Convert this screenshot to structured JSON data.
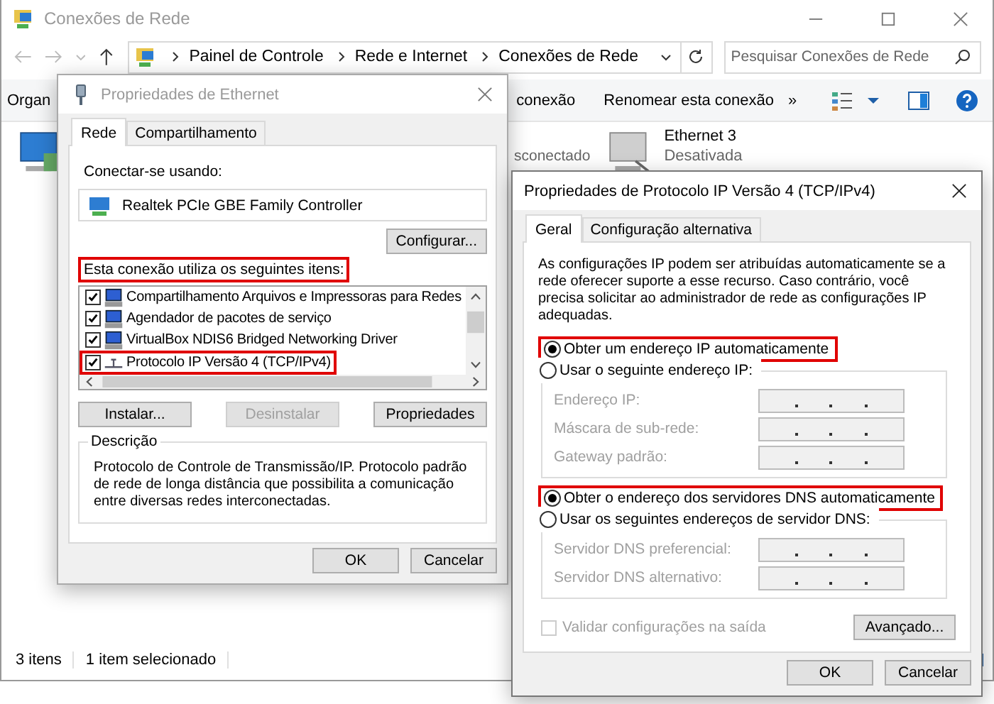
{
  "window": {
    "title": "Conexões de Rede"
  },
  "address_bar": {
    "breadcrumbs": [
      "Painel de Controle",
      "Rede e Internet",
      "Conexões de Rede"
    ]
  },
  "search": {
    "placeholder": "Pesquisar Conexões de Rede"
  },
  "toolbar": {
    "commands": [
      "Organ",
      "conexão",
      "Renomear esta conexão",
      "»"
    ]
  },
  "connections": [
    {
      "status": "sconectado"
    },
    {
      "name": "Ethernet 3",
      "status": "Desativada"
    }
  ],
  "status_bar": [
    "3 itens",
    "1 item selecionado"
  ],
  "ethernet_dialog": {
    "title": "Propriedades de Ethernet",
    "tabs": [
      {
        "label": "Rede",
        "selected": true
      },
      {
        "label": "Compartilhamento",
        "selected": false
      }
    ],
    "connect_label": "Conectar-se usando:",
    "adapter": "Realtek PCIe GBE Family Controller",
    "configure_button": "Configurar...",
    "items_label": {
      "text": "Esta conexão utiliza os seguintes itens:",
      "highlighted": true
    },
    "items": [
      {
        "label": "Compartilhamento Arquivos e Impressoras para Redes",
        "kind": "service",
        "checked": true,
        "highlighted": false
      },
      {
        "label": "Agendador de pacotes de serviço",
        "kind": "service",
        "checked": true,
        "highlighted": false
      },
      {
        "label": "VirtualBox NDIS6 Bridged Networking Driver",
        "kind": "service",
        "checked": true,
        "highlighted": false
      },
      {
        "label": "Protocolo IP Versão 4 (TCP/IPv4)",
        "kind": "protocol",
        "checked": true,
        "highlighted": true
      }
    ],
    "buttons": [
      {
        "label": "Instalar...",
        "disabled": false
      },
      {
        "label": "Desinstalar",
        "disabled": true
      },
      {
        "label": "Propriedades",
        "disabled": false
      }
    ],
    "description_title": "Descrição",
    "description": "Protocolo de Controle de Transmissão/IP. Protocolo padrão de rede de longa distância que possibilita a comunicação entre diversas redes interconectadas.",
    "footer_buttons": [
      "OK",
      "Cancelar"
    ]
  },
  "ipv4_dialog": {
    "title": "Propriedades de Protocolo IP Versão 4 (TCP/IPv4)",
    "tabs": [
      {
        "label": "Geral",
        "selected": true
      },
      {
        "label": "Configuração alternativa",
        "selected": false
      }
    ],
    "intro": "As configurações IP podem ser atribuídas automaticamente se a rede oferecer suporte a esse recurso. Caso contrário, você precisa solicitar ao administrador de rede as configurações IP adequadas.",
    "ip_options": [
      {
        "label": "Obter um endereço IP automaticamente",
        "selected": true,
        "highlighted": true
      },
      {
        "label": "Usar o seguinte endereço IP:",
        "selected": false,
        "highlighted": false
      }
    ],
    "ip_fields": [
      "Endereço IP:",
      "Máscara de sub-rede:",
      "Gateway padrão:"
    ],
    "dns_options": [
      {
        "label": "Obter o endereço dos servidores DNS automaticamente",
        "selected": true,
        "highlighted": true
      },
      {
        "label": "Usar os seguintes endereços de servidor DNS:",
        "selected": false,
        "highlighted": false
      }
    ],
    "dns_fields": [
      "Servidor DNS preferencial:",
      "Servidor DNS alternativo:"
    ],
    "validate": {
      "label": "Validar configurações na saída",
      "checked": false,
      "disabled": true
    },
    "advanced_button": "Avançado...",
    "footer_buttons": [
      "OK",
      "Cancelar"
    ]
  }
}
